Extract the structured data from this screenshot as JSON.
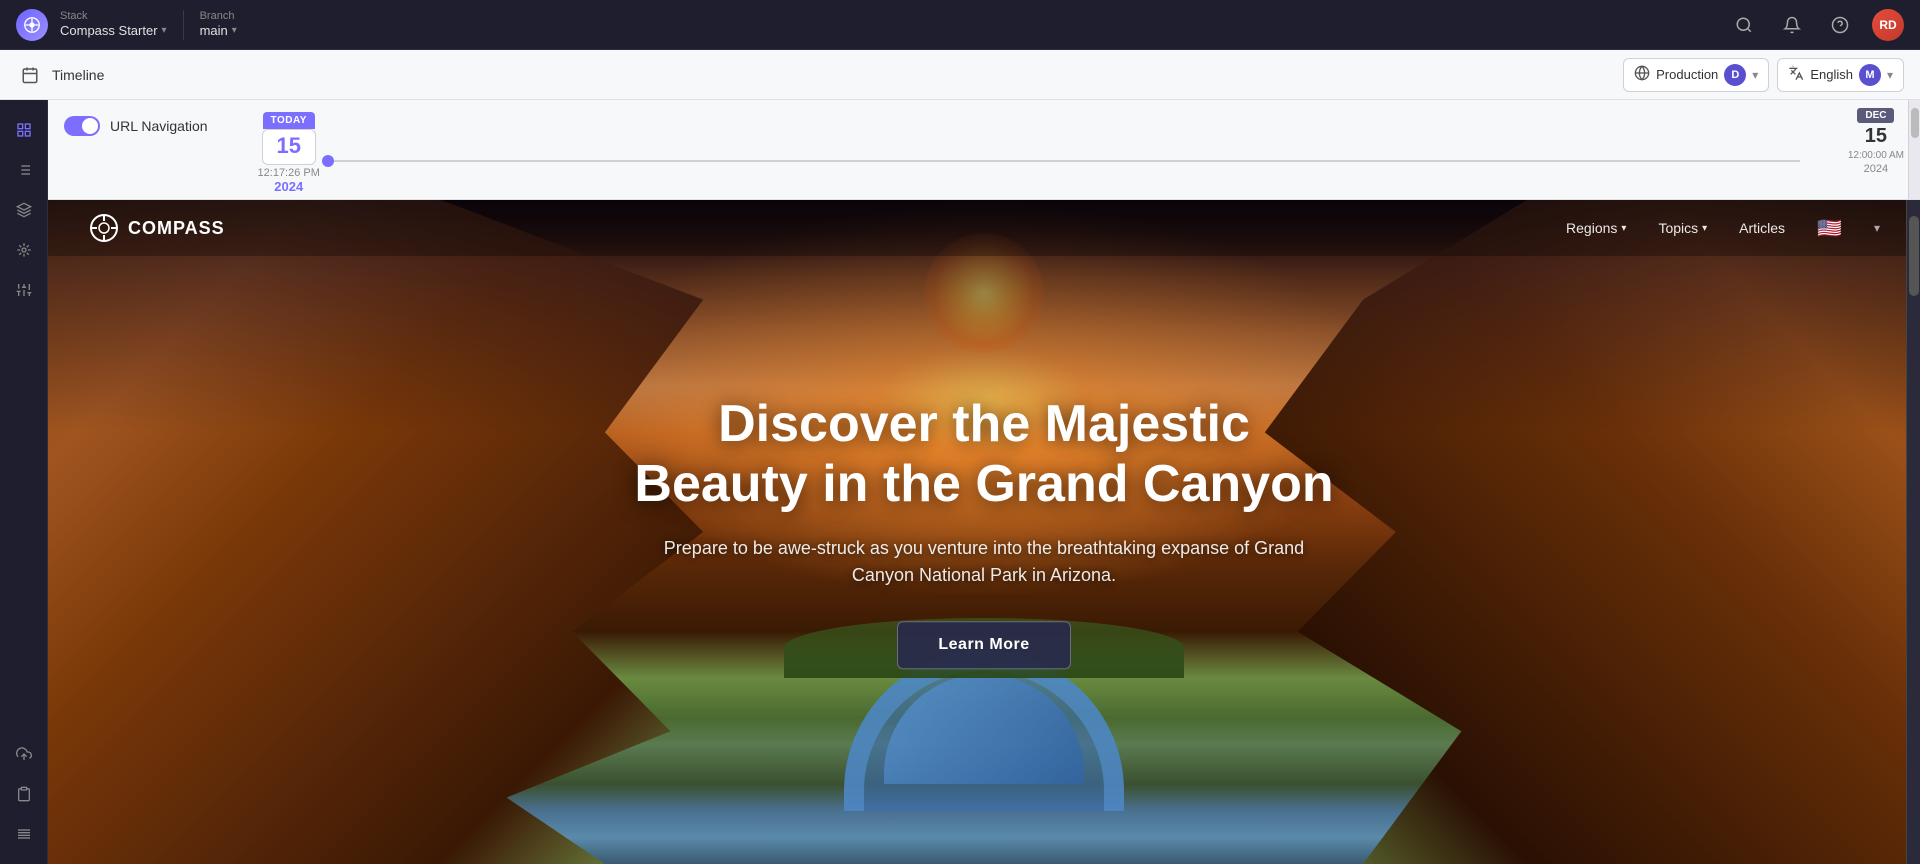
{
  "app": {
    "logo_text": "⊕",
    "user_initials": "RD"
  },
  "stack": {
    "label": "Stack",
    "name": "Compass Starter",
    "chevron": "▾"
  },
  "branch": {
    "label": "Branch",
    "name": "main",
    "chevron": "▾"
  },
  "header_icons": {
    "search": "🔍",
    "bell": "🔔",
    "help": "❓"
  },
  "secondary_bar": {
    "timeline_label": "Timeline"
  },
  "environment": {
    "label": "Production",
    "letter": "D",
    "icon": "🌐"
  },
  "language": {
    "label": "English",
    "letter": "M",
    "icon": "🔤"
  },
  "timeline": {
    "today_badge": "TODAY",
    "date_number": "15",
    "time": "12:17:26 PM",
    "year": "2024"
  },
  "right_timeline": {
    "month": "DEC",
    "date": "15",
    "time": "12:00:00 AM",
    "year": "2024"
  },
  "url_nav": {
    "label": "URL Navigation"
  },
  "compass_nav": {
    "logo_text": "COMPASS",
    "regions": "Regions",
    "topics": "Topics",
    "articles": "Articles",
    "flag": "🇺🇸"
  },
  "hero": {
    "title": "Discover the Majestic Beauty in the Grand Canyon",
    "subtitle": "Prepare to be awe-struck as you venture into the breathtaking expanse of Grand Canyon National Park in Arizona.",
    "cta_button": "Learn More"
  },
  "sidebar": {
    "icons": [
      {
        "name": "grid-icon",
        "symbol": "⊞",
        "active": true
      },
      {
        "name": "list-icon",
        "symbol": "☰",
        "active": false
      },
      {
        "name": "layers-icon",
        "symbol": "⧉",
        "active": false
      },
      {
        "name": "crosshair-icon",
        "symbol": "⊕",
        "active": false
      },
      {
        "name": "sliders-icon",
        "symbol": "⚌",
        "active": false
      },
      {
        "name": "upload-icon",
        "symbol": "⤴",
        "active": false
      },
      {
        "name": "clipboard-icon",
        "symbol": "📋",
        "active": false
      },
      {
        "name": "settings-icon",
        "symbol": "⚙",
        "active": false
      }
    ]
  }
}
